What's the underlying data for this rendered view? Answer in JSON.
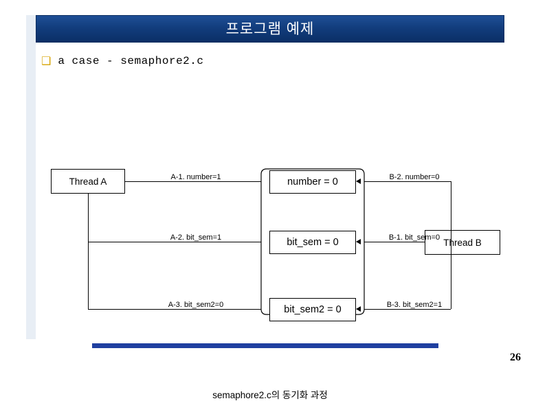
{
  "slide": {
    "title": "프로그램 예제",
    "bullet_marker": "❑",
    "bullet_text": "a case - semaphore2.c",
    "caption": "semaphore2.c의 동기화 과정",
    "page_number": "26",
    "accent_color": "#1f3fa0",
    "title_bar_color": "#123d7d",
    "bullet_color": "#d6a200"
  },
  "diagram": {
    "thread_a_label": "Thread A",
    "thread_b_label": "Thread B",
    "rows": [
      {
        "left_label": "A-1. number=1",
        "center_label": "number = 0",
        "right_label": "B-2. number=0"
      },
      {
        "left_label": "A-2. bit_sem=1",
        "center_label": "bit_sem = 0",
        "right_label": "B-1. bit_sem=0"
      },
      {
        "left_label": "A-3. bit_sem2=0",
        "center_label": "bit_sem2 = 0",
        "right_label": "B-3. bit_sem2=1"
      }
    ]
  }
}
